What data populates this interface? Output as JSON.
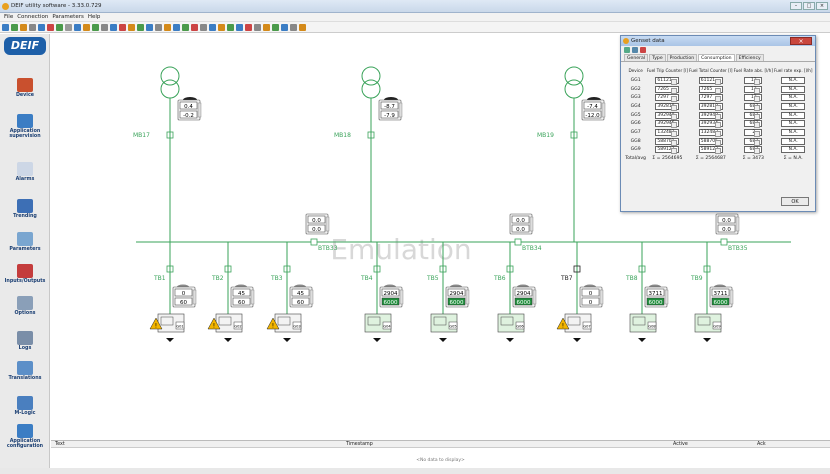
{
  "window": {
    "title": "DEIF utility software - 3.33.0.729"
  },
  "menu": [
    "File",
    "Connection",
    "Parameters",
    "Help"
  ],
  "sidebar": [
    {
      "label": "Device",
      "icon": "device-icon",
      "line2": ""
    },
    {
      "label": "Application",
      "line2": "supervision",
      "icon": "application-supervision-icon"
    },
    {
      "label": "Alarms",
      "icon": "alarms-icon",
      "line2": ""
    },
    {
      "label": "Trending",
      "icon": "trending-icon",
      "line2": ""
    },
    {
      "label": "Parameters",
      "icon": "parameters-icon",
      "line2": ""
    },
    {
      "label": "Inputs/Outputs",
      "icon": "inputs-outputs-icon",
      "line2": ""
    },
    {
      "label": "Options",
      "icon": "options-icon",
      "line2": ""
    },
    {
      "label": "Logs",
      "icon": "logs-icon",
      "line2": ""
    },
    {
      "label": "Translations",
      "icon": "translations-icon",
      "line2": ""
    },
    {
      "label": "M-Logic",
      "icon": "m-logic-icon",
      "line2": ""
    },
    {
      "label": "Application",
      "line2": "configuration",
      "icon": "application-configuration-icon"
    }
  ],
  "mains": [
    {
      "label": "MB17",
      "top": "0.4",
      "bottom": "-0.2",
      "badge": "M"
    },
    {
      "label": "MB18",
      "top": "-8.7",
      "bottom": "-7.9",
      "badge": "M"
    },
    {
      "label": "MB19",
      "top": "-7.4",
      "bottom": "-12.0",
      "badge": "M"
    }
  ],
  "bus_ties": [
    {
      "label": "BTB33",
      "top": "0.0",
      "bottom": "0.0"
    },
    {
      "label": "BTB34",
      "top": "0.0",
      "bottom": "0.0"
    },
    {
      "label": "BTB35",
      "top": "0.0",
      "bottom": "0.0"
    }
  ],
  "gensets": [
    {
      "tb": "TB1",
      "top": "0",
      "bottom": "60",
      "gen": "G01",
      "running": false
    },
    {
      "tb": "TB2",
      "top": "45",
      "bottom": "60",
      "gen": "G02",
      "running": false
    },
    {
      "tb": "TB3",
      "top": "45",
      "bottom": "60",
      "gen": "G03",
      "running": false
    },
    {
      "tb": "TB4",
      "top": "2904",
      "bottom": "6000",
      "gen": "G04",
      "running": true
    },
    {
      "tb": "TB5",
      "top": "2904",
      "bottom": "6000",
      "gen": "G05",
      "running": true
    },
    {
      "tb": "TB6",
      "top": "2904",
      "bottom": "6000",
      "gen": "G06",
      "running": true
    },
    {
      "tb": "TB7",
      "top": "0",
      "bottom": "0",
      "gen": "G07",
      "running": false
    },
    {
      "tb": "TB8",
      "top": "3711",
      "bottom": "6000",
      "gen": "G08",
      "running": true
    },
    {
      "tb": "TB9",
      "top": "3711",
      "bottom": "6000",
      "gen": "G09",
      "running": true
    }
  ],
  "watermark": "Emulation",
  "status_grid": {
    "col_text": "Text",
    "col_timestamp": "Timestamp",
    "col_active": "Active",
    "col_ack": "Ack",
    "empty": "<No data to display>"
  },
  "dialog": {
    "title": "Genset data",
    "tabs": [
      "General",
      "Type",
      "Production",
      "Consumption",
      "Efficiency"
    ],
    "active_tab": "Consumption",
    "headers": [
      "Device",
      "Fuel Trip Counter [l]",
      "Fuel Total Counter [l]",
      "Fuel Rate abs. [l/h]",
      "Fuel rate exp. [l/h]"
    ],
    "rows": [
      [
        "GG1",
        "61121",
        "61121",
        "12",
        "N.A."
      ],
      [
        "GG2",
        "7265",
        "7265",
        "12",
        "N.A."
      ],
      [
        "GG3",
        "7297",
        "7297",
        "12",
        "N.A."
      ],
      [
        "GG4",
        "392810",
        "392810",
        "687",
        "N.A."
      ],
      [
        "GG5",
        "392949",
        "392949",
        "687",
        "N.A."
      ],
      [
        "GG6",
        "392946",
        "392934",
        "687",
        "N.A."
      ],
      [
        "GG7",
        "132483",
        "132483",
        "2",
        "N.A."
      ],
      [
        "GG8",
        "588701",
        "588705",
        "687",
        "N.A."
      ],
      [
        "GG9",
        "589123",
        "589123",
        "687",
        "N.A."
      ]
    ],
    "totals": [
      "Total/avg",
      "Σ = 2564695",
      "Σ = 2564687",
      "Σ = 3473",
      "Σ = N.A."
    ],
    "ok": "OK"
  },
  "colors": {
    "line": "#3aa35a",
    "running": "#1f8f3c",
    "warning": "#f2b400",
    "accent": "#1d5fa8"
  }
}
